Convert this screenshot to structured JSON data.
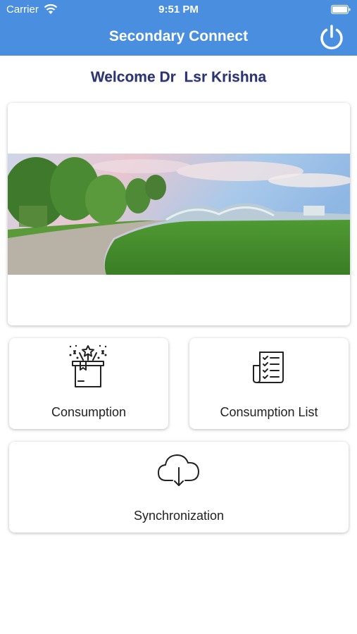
{
  "status_bar": {
    "carrier": "Carrier",
    "time": "9:51 PM"
  },
  "header": {
    "title": "Secondary Connect",
    "power_icon": "power-icon"
  },
  "welcome": {
    "text": "Welcome Dr  Lsr Krishna"
  },
  "banner": {
    "image": "campus-photo"
  },
  "tiles": [
    {
      "label": "Consumption",
      "icon": "gift-box-icon"
    },
    {
      "label": "Consumption List",
      "icon": "checklist-icon"
    },
    {
      "label": "Synchronization",
      "icon": "cloud-download-icon"
    }
  ],
  "colors": {
    "header": "#4a8ee0",
    "welcome_text": "#2d3472",
    "grass": "#3f8a2a"
  }
}
